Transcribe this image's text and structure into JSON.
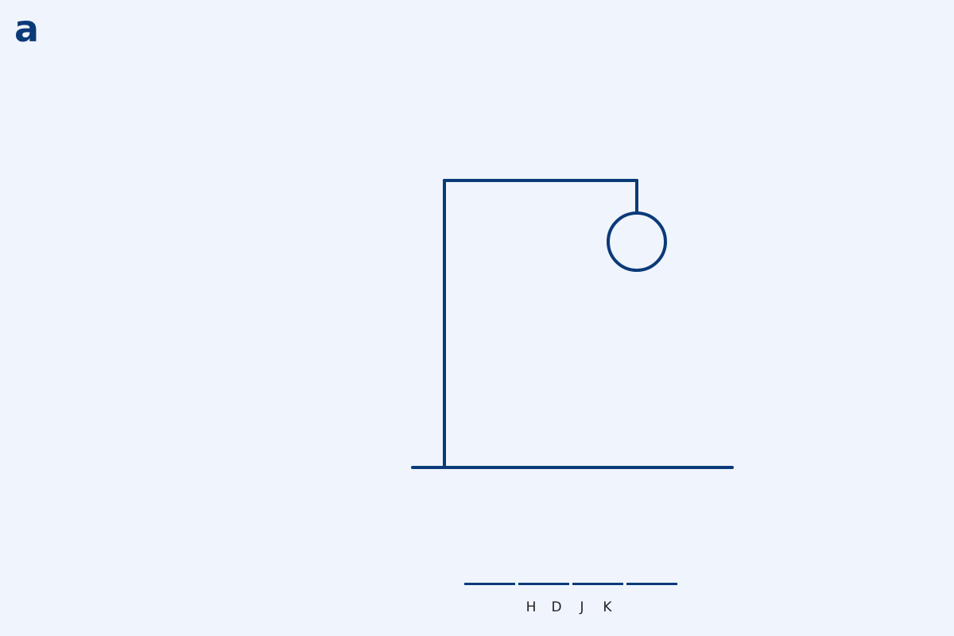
{
  "logo": {
    "text": "a"
  },
  "game": {
    "word_length": 4,
    "wrong_guesses": [
      "H",
      "D",
      "J",
      "K"
    ],
    "stage_parts_drawn": [
      "base",
      "pole",
      "beam",
      "rope",
      "head"
    ]
  },
  "colors": {
    "background": "#f0f4fc",
    "ink": "#0b3a78",
    "text": "#222222"
  },
  "icons": {
    "logo": "a-letter-logo"
  }
}
